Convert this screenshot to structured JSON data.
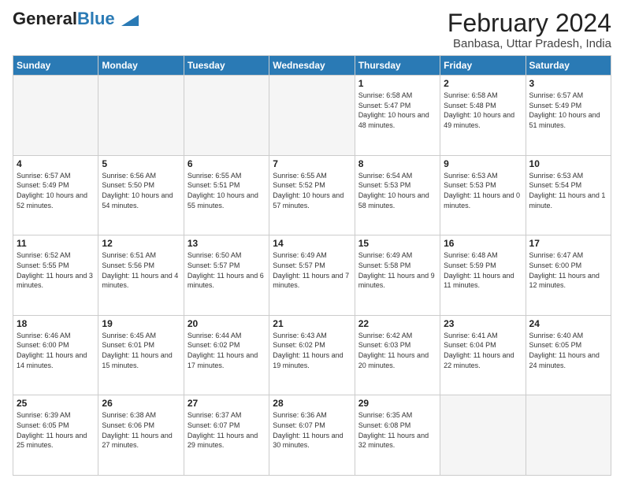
{
  "logo": {
    "general": "General",
    "blue": "Blue"
  },
  "title": "February 2024",
  "location": "Banbasa, Uttar Pradesh, India",
  "weekdays": [
    "Sunday",
    "Monday",
    "Tuesday",
    "Wednesday",
    "Thursday",
    "Friday",
    "Saturday"
  ],
  "weeks": [
    [
      {
        "day": "",
        "empty": true
      },
      {
        "day": "",
        "empty": true
      },
      {
        "day": "",
        "empty": true
      },
      {
        "day": "",
        "empty": true
      },
      {
        "day": "1",
        "sunrise": "6:58 AM",
        "sunset": "5:47 PM",
        "daylight": "10 hours and 48 minutes."
      },
      {
        "day": "2",
        "sunrise": "6:58 AM",
        "sunset": "5:48 PM",
        "daylight": "10 hours and 49 minutes."
      },
      {
        "day": "3",
        "sunrise": "6:57 AM",
        "sunset": "5:49 PM",
        "daylight": "10 hours and 51 minutes."
      }
    ],
    [
      {
        "day": "4",
        "sunrise": "6:57 AM",
        "sunset": "5:49 PM",
        "daylight": "10 hours and 52 minutes."
      },
      {
        "day": "5",
        "sunrise": "6:56 AM",
        "sunset": "5:50 PM",
        "daylight": "10 hours and 54 minutes."
      },
      {
        "day": "6",
        "sunrise": "6:55 AM",
        "sunset": "5:51 PM",
        "daylight": "10 hours and 55 minutes."
      },
      {
        "day": "7",
        "sunrise": "6:55 AM",
        "sunset": "5:52 PM",
        "daylight": "10 hours and 57 minutes."
      },
      {
        "day": "8",
        "sunrise": "6:54 AM",
        "sunset": "5:53 PM",
        "daylight": "10 hours and 58 minutes."
      },
      {
        "day": "9",
        "sunrise": "6:53 AM",
        "sunset": "5:53 PM",
        "daylight": "11 hours and 0 minutes."
      },
      {
        "day": "10",
        "sunrise": "6:53 AM",
        "sunset": "5:54 PM",
        "daylight": "11 hours and 1 minute."
      }
    ],
    [
      {
        "day": "11",
        "sunrise": "6:52 AM",
        "sunset": "5:55 PM",
        "daylight": "11 hours and 3 minutes."
      },
      {
        "day": "12",
        "sunrise": "6:51 AM",
        "sunset": "5:56 PM",
        "daylight": "11 hours and 4 minutes."
      },
      {
        "day": "13",
        "sunrise": "6:50 AM",
        "sunset": "5:57 PM",
        "daylight": "11 hours and 6 minutes."
      },
      {
        "day": "14",
        "sunrise": "6:49 AM",
        "sunset": "5:57 PM",
        "daylight": "11 hours and 7 minutes."
      },
      {
        "day": "15",
        "sunrise": "6:49 AM",
        "sunset": "5:58 PM",
        "daylight": "11 hours and 9 minutes."
      },
      {
        "day": "16",
        "sunrise": "6:48 AM",
        "sunset": "5:59 PM",
        "daylight": "11 hours and 11 minutes."
      },
      {
        "day": "17",
        "sunrise": "6:47 AM",
        "sunset": "6:00 PM",
        "daylight": "11 hours and 12 minutes."
      }
    ],
    [
      {
        "day": "18",
        "sunrise": "6:46 AM",
        "sunset": "6:00 PM",
        "daylight": "11 hours and 14 minutes."
      },
      {
        "day": "19",
        "sunrise": "6:45 AM",
        "sunset": "6:01 PM",
        "daylight": "11 hours and 15 minutes."
      },
      {
        "day": "20",
        "sunrise": "6:44 AM",
        "sunset": "6:02 PM",
        "daylight": "11 hours and 17 minutes."
      },
      {
        "day": "21",
        "sunrise": "6:43 AM",
        "sunset": "6:02 PM",
        "daylight": "11 hours and 19 minutes."
      },
      {
        "day": "22",
        "sunrise": "6:42 AM",
        "sunset": "6:03 PM",
        "daylight": "11 hours and 20 minutes."
      },
      {
        "day": "23",
        "sunrise": "6:41 AM",
        "sunset": "6:04 PM",
        "daylight": "11 hours and 22 minutes."
      },
      {
        "day": "24",
        "sunrise": "6:40 AM",
        "sunset": "6:05 PM",
        "daylight": "11 hours and 24 minutes."
      }
    ],
    [
      {
        "day": "25",
        "sunrise": "6:39 AM",
        "sunset": "6:05 PM",
        "daylight": "11 hours and 25 minutes."
      },
      {
        "day": "26",
        "sunrise": "6:38 AM",
        "sunset": "6:06 PM",
        "daylight": "11 hours and 27 minutes."
      },
      {
        "day": "27",
        "sunrise": "6:37 AM",
        "sunset": "6:07 PM",
        "daylight": "11 hours and 29 minutes."
      },
      {
        "day": "28",
        "sunrise": "6:36 AM",
        "sunset": "6:07 PM",
        "daylight": "11 hours and 30 minutes."
      },
      {
        "day": "29",
        "sunrise": "6:35 AM",
        "sunset": "6:08 PM",
        "daylight": "11 hours and 32 minutes."
      },
      {
        "day": "",
        "empty": true
      },
      {
        "day": "",
        "empty": true
      }
    ]
  ]
}
